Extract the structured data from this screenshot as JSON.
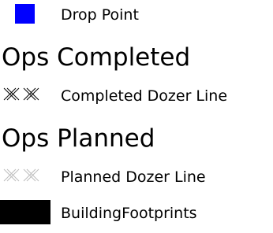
{
  "legend": {
    "drop_point": {
      "label": "Drop Point",
      "icon": "square-symbol-icon",
      "color": "#0000ff"
    },
    "ops_completed": {
      "heading": "Ops Completed",
      "dozer_line": {
        "label": "Completed Dozer Line",
        "icon": "hatched-line-icon",
        "color": "#000000"
      }
    },
    "ops_planned": {
      "heading": "Ops Planned",
      "dozer_line": {
        "label": "Planned Dozer Line",
        "icon": "hatched-line-icon",
        "color": "#bdbdbd"
      }
    },
    "building_footprints": {
      "label": "BuildingFootprints",
      "icon": "filled-rectangle-icon",
      "color": "#000000"
    }
  }
}
